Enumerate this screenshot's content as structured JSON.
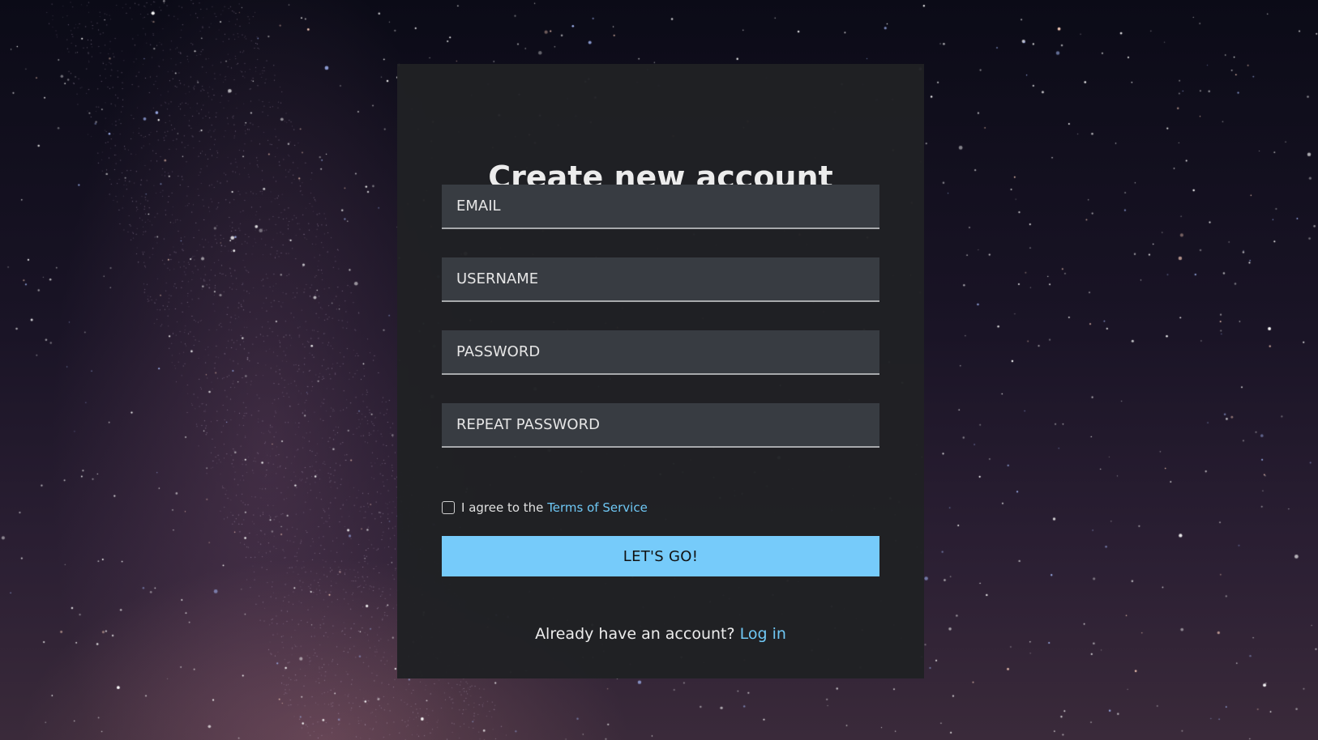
{
  "form": {
    "title": "Create new account",
    "fields": {
      "email_placeholder": "EMAIL",
      "username_placeholder": "USERNAME",
      "password_placeholder": "PASSWORD",
      "repeat_password_placeholder": "REPEAT PASSWORD"
    },
    "agree": {
      "text": "I agree to the ",
      "link_label": "Terms of Service",
      "checked": false
    },
    "submit_label": "LET'S GO!",
    "footer": {
      "text": "Already have an account? ",
      "link_label": "Log in"
    }
  },
  "colors": {
    "accent": "#76cbfa",
    "link": "#6fc8f5",
    "card_background": "#202124",
    "field_background": "#383c42"
  },
  "icons": {
    "background": "starry-night-sky"
  }
}
